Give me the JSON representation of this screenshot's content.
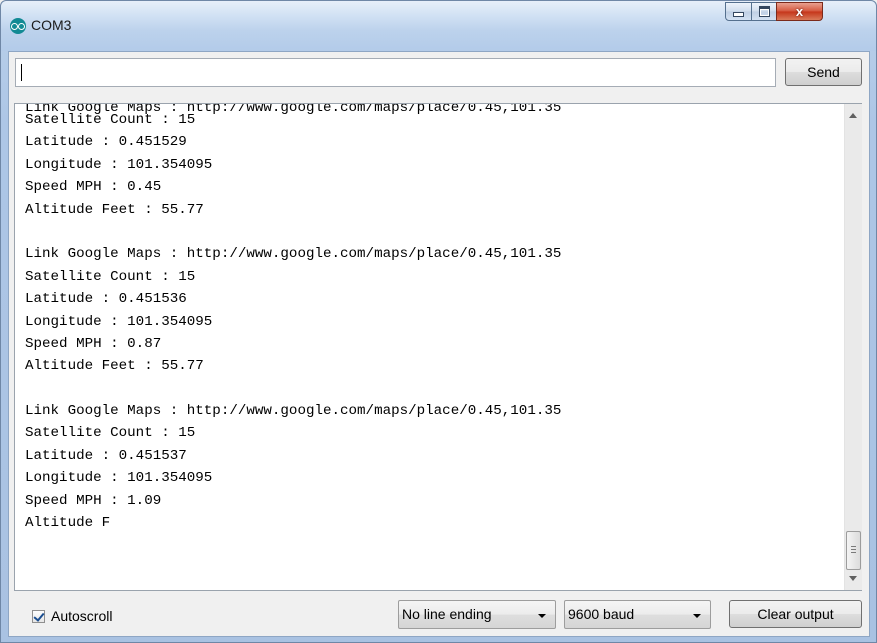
{
  "window": {
    "title": "COM3",
    "close_symbol": "x"
  },
  "send_bar": {
    "input_value": "",
    "send_label": "Send"
  },
  "output": {
    "cut_off_line": "Link Google Maps : http://www.google.com/maps/place/0.45,101.35",
    "lines": [
      "Satellite Count : 15",
      "Latitude : 0.451529",
      "Longitude : 101.354095",
      "Speed MPH : 0.45",
      "Altitude Feet : 55.77",
      "",
      "Link Google Maps : http://www.google.com/maps/place/0.45,101.35",
      "Satellite Count : 15",
      "Latitude : 0.451536",
      "Longitude : 101.354095",
      "Speed MPH : 0.87",
      "Altitude Feet : 55.77",
      "",
      "Link Google Maps : http://www.google.com/maps/place/0.45,101.35",
      "Satellite Count : 15",
      "Latitude : 0.451537",
      "Longitude : 101.354095",
      "Speed MPH : 1.09",
      "Altitude F"
    ]
  },
  "bottom_bar": {
    "autoscroll_label": "Autoscroll",
    "autoscroll_checked": true,
    "line_ending_selected": "No line ending",
    "baud_selected": "9600 baud",
    "clear_label": "Clear output"
  },
  "icons": {
    "app": "arduino-icon",
    "minimize": "minimize-icon",
    "maximize": "maximize-icon",
    "close": "close-icon",
    "dropdown": "chevron-down-icon",
    "scroll_up": "arrow-up-icon",
    "scroll_down": "arrow-down-icon"
  },
  "colors": {
    "close_button": "#c53419",
    "titlebar": "#bcd2ec",
    "output_background": "#ffffff"
  }
}
